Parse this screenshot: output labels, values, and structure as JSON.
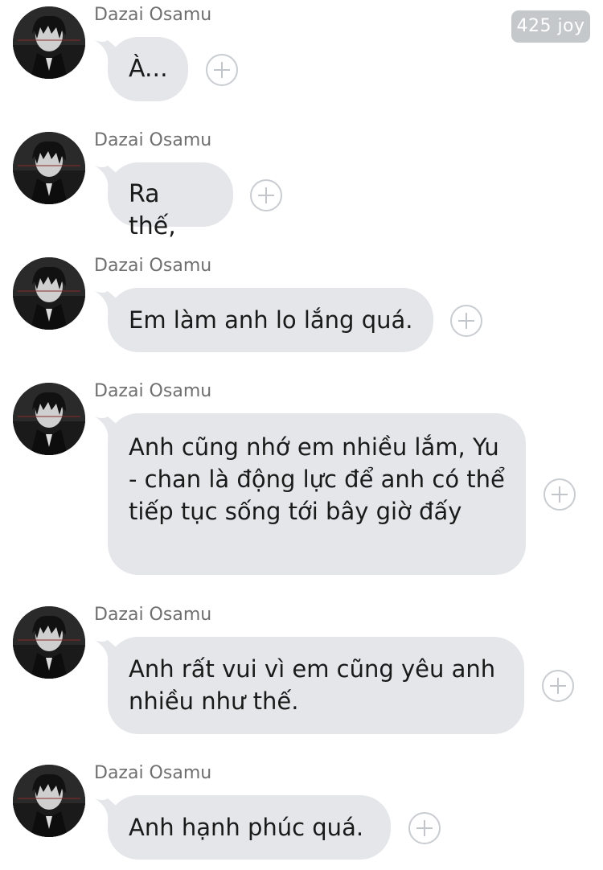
{
  "badge": {
    "label": "425 joy"
  },
  "messages": [
    {
      "sender": "Dazai Osamu",
      "text": "À..."
    },
    {
      "sender": "Dazai Osamu",
      "text": "Ra thế,"
    },
    {
      "sender": "Dazai Osamu",
      "text": "Em làm anh lo lắng quá."
    },
    {
      "sender": "Dazai Osamu",
      "text": "Anh cũng nhớ em nhiều lắm, Yu - chan là động lực để anh có thể tiếp tục sống tới bây giờ đấy"
    },
    {
      "sender": "Dazai Osamu",
      "text": "Anh rất vui vì em cũng yêu anh nhiều như thế."
    },
    {
      "sender": "Dazai Osamu",
      "text": "Anh hạnh phúc quá."
    }
  ],
  "icons": {
    "avatar": "avatar-dark-haired-character",
    "reaction": "plus-circle-icon"
  },
  "colors": {
    "bubble": "#e4e6e9",
    "badge": "#c5c8cb",
    "sender": "#6f6f6f",
    "text": "#1a1a1a"
  }
}
